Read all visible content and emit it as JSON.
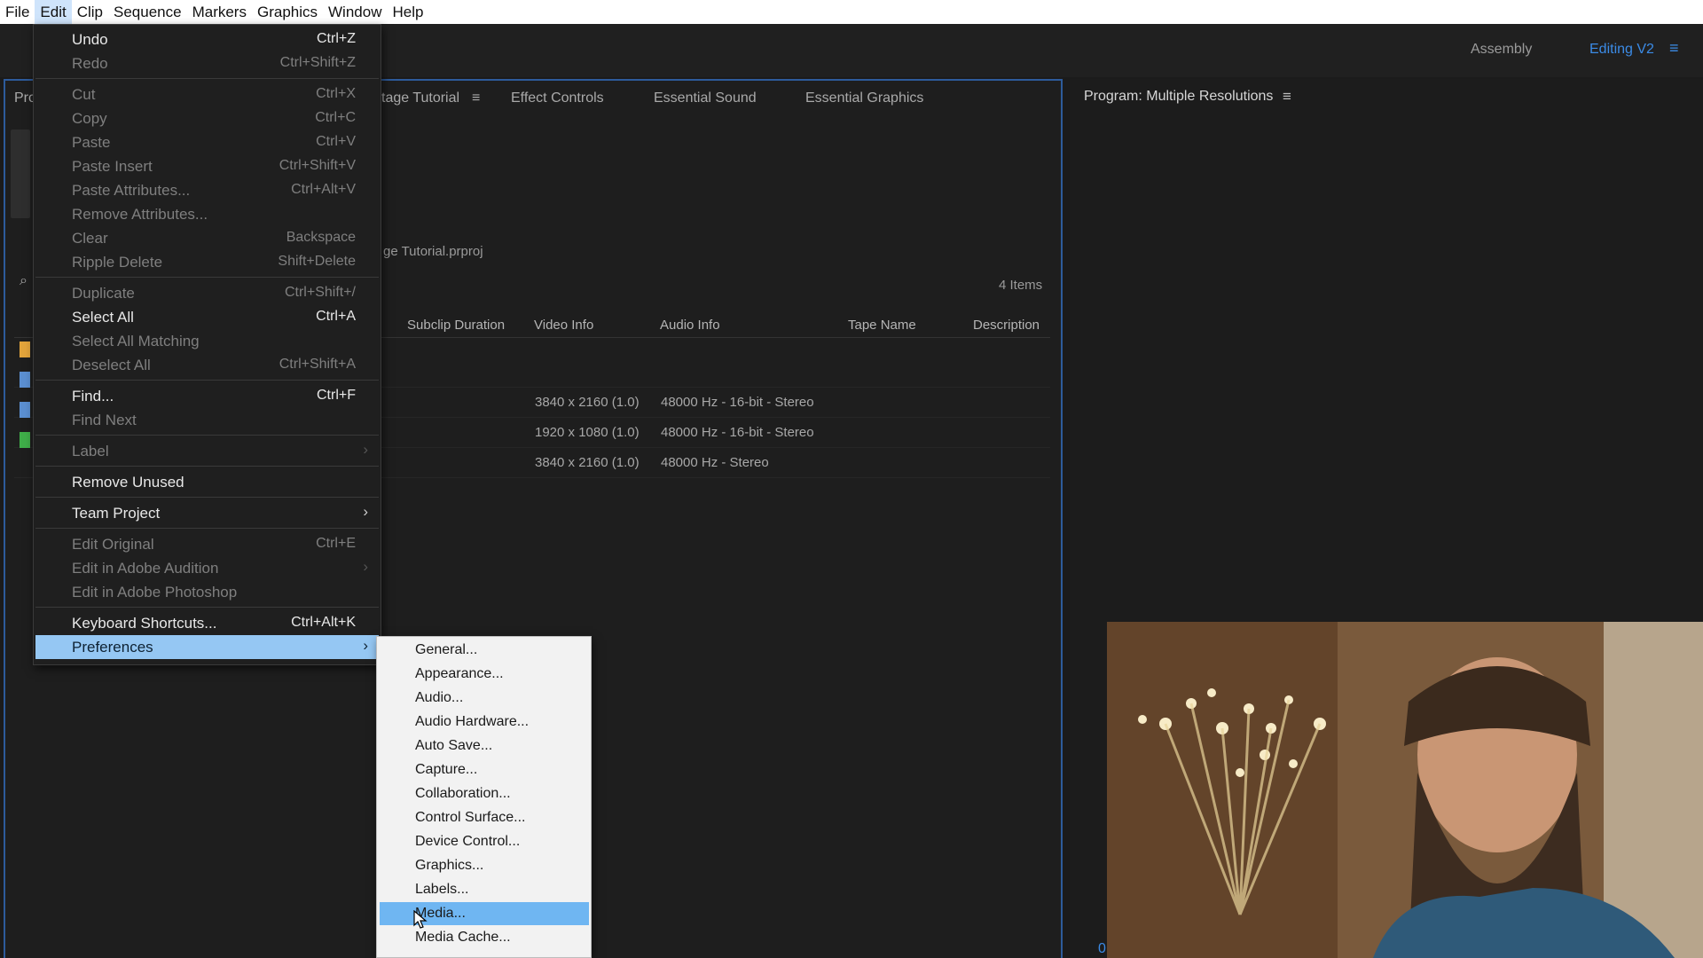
{
  "menubar": {
    "items": [
      "File",
      "Edit",
      "Clip",
      "Sequence",
      "Markers",
      "Graphics",
      "Window",
      "Help"
    ],
    "active": "Edit"
  },
  "workspaces": {
    "assembly": "Assembly",
    "editing": "Editing V2",
    "menu_icon": "hamburger-icon"
  },
  "project_panel": {
    "tab_partial": "Pro",
    "tab_main": "tage Tutorial",
    "tab_menu_icon": "hamburger-icon",
    "tabs": [
      "Effect Controls",
      "Essential Sound",
      "Essential Graphics"
    ],
    "project_path": "ge Tutorial.prproj",
    "items_count": "4 Items",
    "columns": [
      "Subclip Duration",
      "Video Info",
      "Audio Info",
      "Tape Name",
      "Description"
    ],
    "rows": [
      {
        "video_info": "3840 x 2160 (1.0)",
        "audio_info": "48000 Hz - 16-bit - Stereo"
      },
      {
        "video_info": "1920 x 1080 (1.0)",
        "audio_info": "48000 Hz - 16-bit - Stereo"
      },
      {
        "video_info": "3840 x 2160 (1.0)",
        "audio_info": "48000 Hz - Stereo"
      }
    ],
    "label_colors": [
      "#e2a43b",
      "#5b8fd1",
      "#5b8fd1",
      "#3fae49"
    ]
  },
  "program_monitor": {
    "title": "Program: Multiple Resolutions",
    "menu_icon": "hamburger-icon",
    "timecode": "0"
  },
  "edit_menu": {
    "items": [
      {
        "label": "Undo",
        "shortcut": "Ctrl+Z",
        "enabled": true
      },
      {
        "label": "Redo",
        "shortcut": "Ctrl+Shift+Z",
        "enabled": false
      },
      {
        "label": "Cut",
        "shortcut": "Ctrl+X",
        "enabled": false
      },
      {
        "label": "Copy",
        "shortcut": "Ctrl+C",
        "enabled": false
      },
      {
        "label": "Paste",
        "shortcut": "Ctrl+V",
        "enabled": false
      },
      {
        "label": "Paste Insert",
        "shortcut": "Ctrl+Shift+V",
        "enabled": false
      },
      {
        "label": "Paste Attributes...",
        "shortcut": "Ctrl+Alt+V",
        "enabled": false
      },
      {
        "label": "Remove Attributes...",
        "shortcut": "",
        "enabled": false
      },
      {
        "label": "Clear",
        "shortcut": "Backspace",
        "enabled": false
      },
      {
        "label": "Ripple Delete",
        "shortcut": "Shift+Delete",
        "enabled": false
      },
      {
        "label": "Duplicate",
        "shortcut": "Ctrl+Shift+/",
        "enabled": false
      },
      {
        "label": "Select All",
        "shortcut": "Ctrl+A",
        "enabled": true
      },
      {
        "label": "Select All Matching",
        "shortcut": "",
        "enabled": false
      },
      {
        "label": "Deselect All",
        "shortcut": "Ctrl+Shift+A",
        "enabled": false
      },
      {
        "label": "Find...",
        "shortcut": "Ctrl+F",
        "enabled": true
      },
      {
        "label": "Find Next",
        "shortcut": "",
        "enabled": false
      },
      {
        "label": "Label",
        "shortcut": "",
        "enabled": false,
        "submenu": true
      },
      {
        "label": "Remove Unused",
        "shortcut": "",
        "enabled": true
      },
      {
        "label": "Team Project",
        "shortcut": "",
        "enabled": true,
        "submenu": true
      },
      {
        "label": "Edit Original",
        "shortcut": "Ctrl+E",
        "enabled": false
      },
      {
        "label": "Edit in Adobe Audition",
        "shortcut": "",
        "enabled": false,
        "submenu": true
      },
      {
        "label": "Edit in Adobe Photoshop",
        "shortcut": "",
        "enabled": false
      },
      {
        "label": "Keyboard Shortcuts...",
        "shortcut": "Ctrl+Alt+K",
        "enabled": true
      },
      {
        "label": "Preferences",
        "shortcut": "",
        "enabled": true,
        "submenu": true,
        "highlighted": true
      }
    ],
    "submenu_arrow": "chevron-right-icon"
  },
  "preferences_menu": {
    "items": [
      "General...",
      "Appearance...",
      "Audio...",
      "Audio Hardware...",
      "Auto Save...",
      "Capture...",
      "Collaboration...",
      "Control Surface...",
      "Device Control...",
      "Graphics...",
      "Labels...",
      "Media...",
      "Media Cache..."
    ],
    "highlighted": "Media..."
  }
}
